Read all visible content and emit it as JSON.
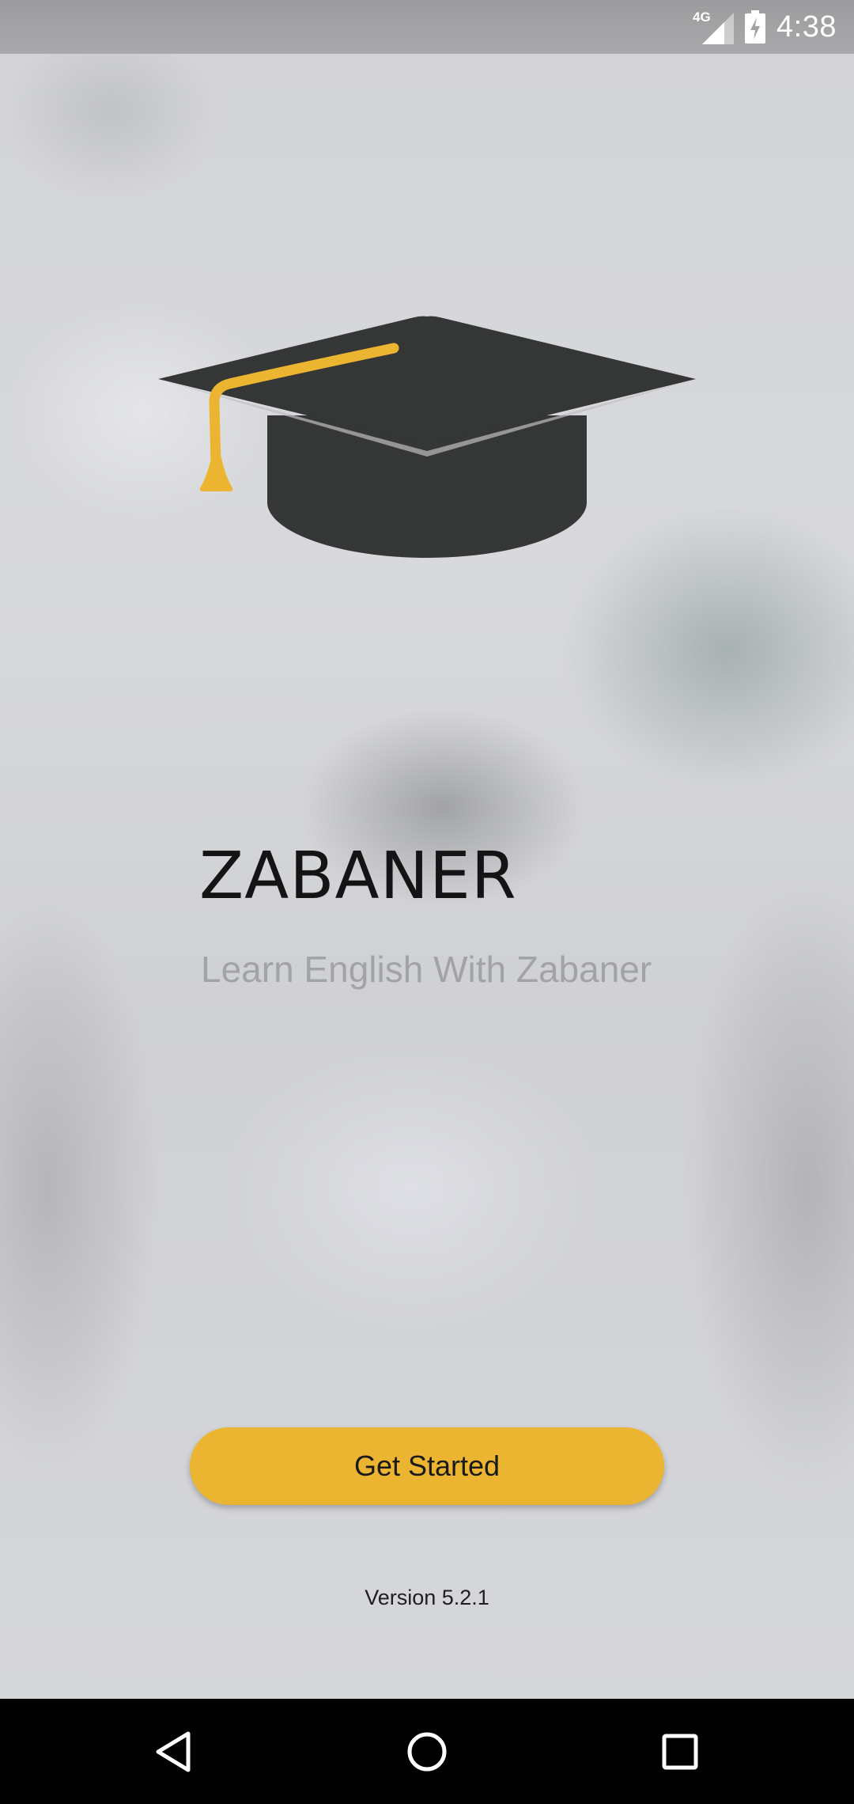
{
  "status_bar": {
    "network": "4G",
    "time": "4:38",
    "icons": [
      "signal-icon",
      "battery-charging-icon"
    ]
  },
  "splash": {
    "logo_icon": "graduation-cap-icon",
    "title": "ZABANER",
    "subtitle": "Learn English With Zabaner",
    "button_label": "Get Started",
    "version": "Version 5.2.1"
  },
  "colors": {
    "accent": "#EBB531",
    "cap": "#353636",
    "title": "#141414",
    "subtitle": "#A2A3A6",
    "nav_bar": "#000000"
  },
  "nav_bar": {
    "icons": [
      "back-icon",
      "home-icon",
      "recents-icon"
    ]
  }
}
